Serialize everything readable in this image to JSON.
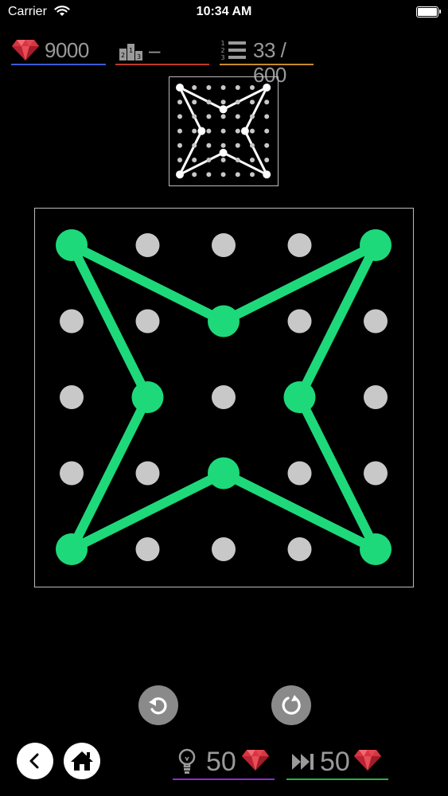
{
  "status_bar": {
    "carrier": "Carrier",
    "time": "10:34 AM"
  },
  "stats": {
    "gems": "9000",
    "rank": "–",
    "level": "33 / 600",
    "gems_line_color": "#3b5bd6",
    "rank_line_color": "#c0392b",
    "level_line_color": "#c78a2a"
  },
  "board": {
    "grid_size": 5,
    "dot_color": "#c8c8c8",
    "line_color": "#1ed97a",
    "shape_vertices": [
      [
        0,
        0
      ],
      [
        2,
        1
      ],
      [
        4,
        0
      ],
      [
        3,
        2
      ],
      [
        4,
        4
      ],
      [
        2,
        3
      ],
      [
        0,
        4
      ],
      [
        1,
        2
      ]
    ]
  },
  "preview": {
    "grid_size": 5,
    "dot_color": "#c8c8c8",
    "line_color": "#ffffff"
  },
  "controls": {
    "undo_icon": "undo-icon",
    "reset_icon": "reset-icon"
  },
  "bottom": {
    "hint_cost": "50",
    "skip_cost": "50",
    "hint_line_color": "#8e2bd6",
    "skip_line_color": "#2bb04a"
  }
}
